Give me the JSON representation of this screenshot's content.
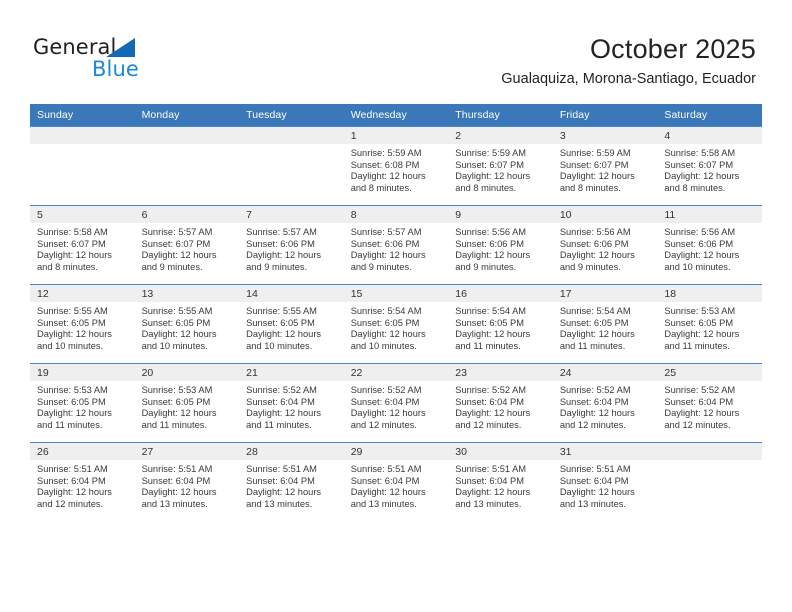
{
  "brand": {
    "name_top": "General",
    "name_bottom": "Blue",
    "triangle_icon": "triangle-icon",
    "accent_dark": "#1569b4",
    "accent_light": "#1d87d8"
  },
  "header": {
    "title": "October 2025",
    "subtitle": "Gualaquiza, Morona-Santiago, Ecuador"
  },
  "theme": {
    "header_blue": "#3a78ba",
    "row_divider": "#4a86c5",
    "daynum_band": "#efefef",
    "text": "#3a3a3a"
  },
  "weekday_headers": [
    "Sunday",
    "Monday",
    "Tuesday",
    "Wednesday",
    "Thursday",
    "Friday",
    "Saturday"
  ],
  "weeks": [
    [
      {
        "day": "",
        "sunrise": "",
        "sunset": "",
        "daylight1": "",
        "daylight2": ""
      },
      {
        "day": "",
        "sunrise": "",
        "sunset": "",
        "daylight1": "",
        "daylight2": ""
      },
      {
        "day": "",
        "sunrise": "",
        "sunset": "",
        "daylight1": "",
        "daylight2": ""
      },
      {
        "day": "1",
        "sunrise": "Sunrise: 5:59 AM",
        "sunset": "Sunset: 6:08 PM",
        "daylight1": "Daylight: 12 hours",
        "daylight2": "and 8 minutes."
      },
      {
        "day": "2",
        "sunrise": "Sunrise: 5:59 AM",
        "sunset": "Sunset: 6:07 PM",
        "daylight1": "Daylight: 12 hours",
        "daylight2": "and 8 minutes."
      },
      {
        "day": "3",
        "sunrise": "Sunrise: 5:59 AM",
        "sunset": "Sunset: 6:07 PM",
        "daylight1": "Daylight: 12 hours",
        "daylight2": "and 8 minutes."
      },
      {
        "day": "4",
        "sunrise": "Sunrise: 5:58 AM",
        "sunset": "Sunset: 6:07 PM",
        "daylight1": "Daylight: 12 hours",
        "daylight2": "and 8 minutes."
      }
    ],
    [
      {
        "day": "5",
        "sunrise": "Sunrise: 5:58 AM",
        "sunset": "Sunset: 6:07 PM",
        "daylight1": "Daylight: 12 hours",
        "daylight2": "and 8 minutes."
      },
      {
        "day": "6",
        "sunrise": "Sunrise: 5:57 AM",
        "sunset": "Sunset: 6:07 PM",
        "daylight1": "Daylight: 12 hours",
        "daylight2": "and 9 minutes."
      },
      {
        "day": "7",
        "sunrise": "Sunrise: 5:57 AM",
        "sunset": "Sunset: 6:06 PM",
        "daylight1": "Daylight: 12 hours",
        "daylight2": "and 9 minutes."
      },
      {
        "day": "8",
        "sunrise": "Sunrise: 5:57 AM",
        "sunset": "Sunset: 6:06 PM",
        "daylight1": "Daylight: 12 hours",
        "daylight2": "and 9 minutes."
      },
      {
        "day": "9",
        "sunrise": "Sunrise: 5:56 AM",
        "sunset": "Sunset: 6:06 PM",
        "daylight1": "Daylight: 12 hours",
        "daylight2": "and 9 minutes."
      },
      {
        "day": "10",
        "sunrise": "Sunrise: 5:56 AM",
        "sunset": "Sunset: 6:06 PM",
        "daylight1": "Daylight: 12 hours",
        "daylight2": "and 9 minutes."
      },
      {
        "day": "11",
        "sunrise": "Sunrise: 5:56 AM",
        "sunset": "Sunset: 6:06 PM",
        "daylight1": "Daylight: 12 hours",
        "daylight2": "and 10 minutes."
      }
    ],
    [
      {
        "day": "12",
        "sunrise": "Sunrise: 5:55 AM",
        "sunset": "Sunset: 6:05 PM",
        "daylight1": "Daylight: 12 hours",
        "daylight2": "and 10 minutes."
      },
      {
        "day": "13",
        "sunrise": "Sunrise: 5:55 AM",
        "sunset": "Sunset: 6:05 PM",
        "daylight1": "Daylight: 12 hours",
        "daylight2": "and 10 minutes."
      },
      {
        "day": "14",
        "sunrise": "Sunrise: 5:55 AM",
        "sunset": "Sunset: 6:05 PM",
        "daylight1": "Daylight: 12 hours",
        "daylight2": "and 10 minutes."
      },
      {
        "day": "15",
        "sunrise": "Sunrise: 5:54 AM",
        "sunset": "Sunset: 6:05 PM",
        "daylight1": "Daylight: 12 hours",
        "daylight2": "and 10 minutes."
      },
      {
        "day": "16",
        "sunrise": "Sunrise: 5:54 AM",
        "sunset": "Sunset: 6:05 PM",
        "daylight1": "Daylight: 12 hours",
        "daylight2": "and 11 minutes."
      },
      {
        "day": "17",
        "sunrise": "Sunrise: 5:54 AM",
        "sunset": "Sunset: 6:05 PM",
        "daylight1": "Daylight: 12 hours",
        "daylight2": "and 11 minutes."
      },
      {
        "day": "18",
        "sunrise": "Sunrise: 5:53 AM",
        "sunset": "Sunset: 6:05 PM",
        "daylight1": "Daylight: 12 hours",
        "daylight2": "and 11 minutes."
      }
    ],
    [
      {
        "day": "19",
        "sunrise": "Sunrise: 5:53 AM",
        "sunset": "Sunset: 6:05 PM",
        "daylight1": "Daylight: 12 hours",
        "daylight2": "and 11 minutes."
      },
      {
        "day": "20",
        "sunrise": "Sunrise: 5:53 AM",
        "sunset": "Sunset: 6:05 PM",
        "daylight1": "Daylight: 12 hours",
        "daylight2": "and 11 minutes."
      },
      {
        "day": "21",
        "sunrise": "Sunrise: 5:52 AM",
        "sunset": "Sunset: 6:04 PM",
        "daylight1": "Daylight: 12 hours",
        "daylight2": "and 11 minutes."
      },
      {
        "day": "22",
        "sunrise": "Sunrise: 5:52 AM",
        "sunset": "Sunset: 6:04 PM",
        "daylight1": "Daylight: 12 hours",
        "daylight2": "and 12 minutes."
      },
      {
        "day": "23",
        "sunrise": "Sunrise: 5:52 AM",
        "sunset": "Sunset: 6:04 PM",
        "daylight1": "Daylight: 12 hours",
        "daylight2": "and 12 minutes."
      },
      {
        "day": "24",
        "sunrise": "Sunrise: 5:52 AM",
        "sunset": "Sunset: 6:04 PM",
        "daylight1": "Daylight: 12 hours",
        "daylight2": "and 12 minutes."
      },
      {
        "day": "25",
        "sunrise": "Sunrise: 5:52 AM",
        "sunset": "Sunset: 6:04 PM",
        "daylight1": "Daylight: 12 hours",
        "daylight2": "and 12 minutes."
      }
    ],
    [
      {
        "day": "26",
        "sunrise": "Sunrise: 5:51 AM",
        "sunset": "Sunset: 6:04 PM",
        "daylight1": "Daylight: 12 hours",
        "daylight2": "and 12 minutes."
      },
      {
        "day": "27",
        "sunrise": "Sunrise: 5:51 AM",
        "sunset": "Sunset: 6:04 PM",
        "daylight1": "Daylight: 12 hours",
        "daylight2": "and 13 minutes."
      },
      {
        "day": "28",
        "sunrise": "Sunrise: 5:51 AM",
        "sunset": "Sunset: 6:04 PM",
        "daylight1": "Daylight: 12 hours",
        "daylight2": "and 13 minutes."
      },
      {
        "day": "29",
        "sunrise": "Sunrise: 5:51 AM",
        "sunset": "Sunset: 6:04 PM",
        "daylight1": "Daylight: 12 hours",
        "daylight2": "and 13 minutes."
      },
      {
        "day": "30",
        "sunrise": "Sunrise: 5:51 AM",
        "sunset": "Sunset: 6:04 PM",
        "daylight1": "Daylight: 12 hours",
        "daylight2": "and 13 minutes."
      },
      {
        "day": "31",
        "sunrise": "Sunrise: 5:51 AM",
        "sunset": "Sunset: 6:04 PM",
        "daylight1": "Daylight: 12 hours",
        "daylight2": "and 13 minutes."
      },
      {
        "day": "",
        "sunrise": "",
        "sunset": "",
        "daylight1": "",
        "daylight2": ""
      }
    ]
  ]
}
